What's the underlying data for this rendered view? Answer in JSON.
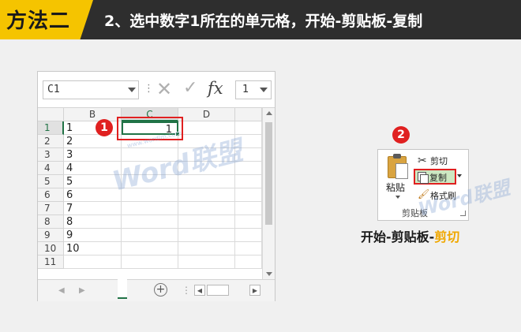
{
  "header": {
    "method_label": "方法二",
    "step_title": "2、选中数字1所在的单元格，开始-剪贴板-复制"
  },
  "excel": {
    "name_box": "C1",
    "formula_value": "1",
    "fx_label": "fx",
    "columns": [
      "B",
      "C",
      "D"
    ],
    "selected_column": "C",
    "rows": [
      {
        "num": "1",
        "b": "1",
        "c": "1"
      },
      {
        "num": "2",
        "b": "2",
        "c": ""
      },
      {
        "num": "3",
        "b": "3",
        "c": ""
      },
      {
        "num": "4",
        "b": "4",
        "c": ""
      },
      {
        "num": "5",
        "b": "5",
        "c": ""
      },
      {
        "num": "6",
        "b": "6",
        "c": ""
      },
      {
        "num": "7",
        "b": "7",
        "c": ""
      },
      {
        "num": "8",
        "b": "8",
        "c": ""
      },
      {
        "num": "9",
        "b": "9",
        "c": ""
      },
      {
        "num": "10",
        "b": "10",
        "c": ""
      },
      {
        "num": "11",
        "b": "",
        "c": ""
      }
    ],
    "step_marker": "1"
  },
  "clipboard": {
    "step_marker": "2",
    "paste_label": "粘贴",
    "cut_label": "剪切",
    "copy_label": "复制",
    "format_painter_label": "格式刷",
    "group_label": "剪贴板"
  },
  "caption": {
    "prefix": "开始-剪贴板-",
    "highlight": "剪切"
  },
  "watermark": {
    "brand": "Word联盟",
    "url": "www.wordlm.com"
  },
  "colors": {
    "accent_yellow": "#f5c400",
    "header_dark": "#2e2e2e",
    "excel_green": "#217346",
    "highlight_red": "#e02020",
    "caption_orange": "#f0a800"
  }
}
